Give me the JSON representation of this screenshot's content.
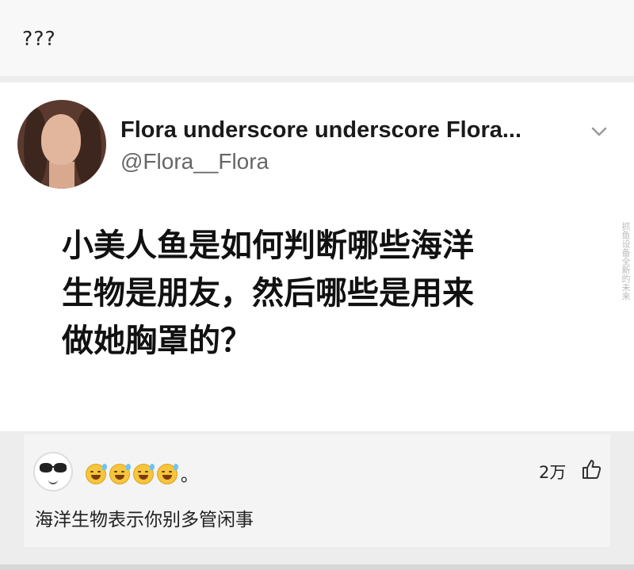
{
  "top": {
    "text": "???"
  },
  "tweet": {
    "name": "Flora underscore underscore Flora...",
    "handle": "@Flora__Flora",
    "line1": "小美人鱼是如何判断哪些海洋",
    "line2": "生物是朋友，然后哪些是用来",
    "line3": "做她胸罩的？",
    "watermark": "抓鱼设备全新的未来"
  },
  "comment": {
    "emoji_suffix": "。",
    "likes": "2万",
    "text": "海洋生物表示你别多管闲事"
  },
  "icons": {
    "expand": "chevron-down-icon",
    "like": "thumbs-up-icon"
  }
}
